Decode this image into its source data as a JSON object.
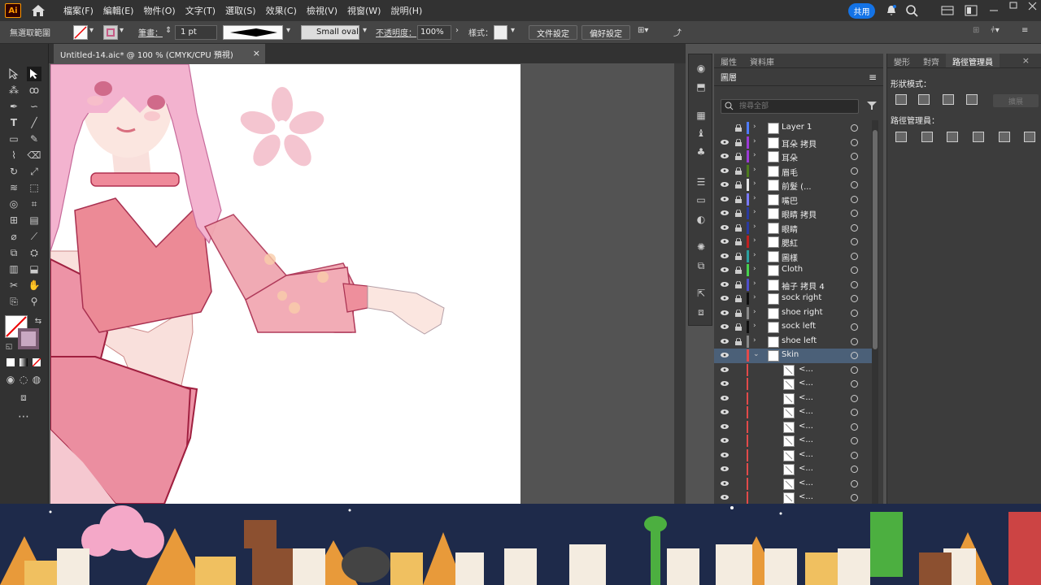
{
  "app": {
    "logo": "Ai",
    "share_label": "共用"
  },
  "menu": [
    "檔案(F)",
    "編輯(E)",
    "物件(O)",
    "文字(T)",
    "選取(S)",
    "效果(C)",
    "檢視(V)",
    "視窗(W)",
    "說明(H)"
  ],
  "control": {
    "selection": "無選取範圍",
    "stroke_label": "筆畫：",
    "stroke_value": "1 pt",
    "brush": "Small oval",
    "opacity_label": "不透明度：",
    "opacity_value": "100%",
    "style_label": "樣式：",
    "doc_setup": "文件設定",
    "prefs": "偏好設定"
  },
  "document": {
    "tab_title": "Untitled-14.aic* @ 100 % (CMYK/CPU 預視)",
    "close": "×"
  },
  "layers_panel": {
    "tabs": [
      "屬性",
      "資料庫"
    ],
    "header": "圖層",
    "search_placeholder": "搜尋全部",
    "layers": [
      {
        "name": "Layer 1",
        "color": "#4f7cff"
      },
      {
        "name": "耳朵 拷貝",
        "color": "#9b3ad6"
      },
      {
        "name": "耳朵",
        "color": "#9b3ad6"
      },
      {
        "name": "眉毛",
        "color": "#4e7a1e"
      },
      {
        "name": "前髮 (...",
        "color": "#e6e6e6"
      },
      {
        "name": "嘴巴",
        "color": "#7a7aff"
      },
      {
        "name": "眼睛 拷貝",
        "color": "#2a3aa0"
      },
      {
        "name": "眼睛",
        "color": "#2a3aa0"
      },
      {
        "name": "腮紅",
        "color": "#c02020"
      },
      {
        "name": "圖樣",
        "color": "#2aa0a0"
      },
      {
        "name": "Cloth",
        "color": "#46d24e"
      },
      {
        "name": "袖子 拷貝 4",
        "color": "#4f4fcc"
      },
      {
        "name": "sock right",
        "color": "#111111"
      },
      {
        "name": "shoe right",
        "color": "#888888"
      },
      {
        "name": "sock left",
        "color": "#111111"
      },
      {
        "name": "shoe left",
        "color": "#888888"
      },
      {
        "name": "Skin",
        "color": "#e24a4a"
      }
    ],
    "sublayer_label": "<...",
    "sublayer_count": 10
  },
  "pathfinder_panel": {
    "tabs": [
      "變形",
      "對齊",
      "路徑管理員"
    ],
    "shape_modes": "形狀模式：",
    "expand": "擴展",
    "pathfinders": "路徑管理員："
  },
  "colors": {
    "accent": "#1473e6",
    "selection": "#4b6078",
    "logo": "#ff9a00"
  }
}
